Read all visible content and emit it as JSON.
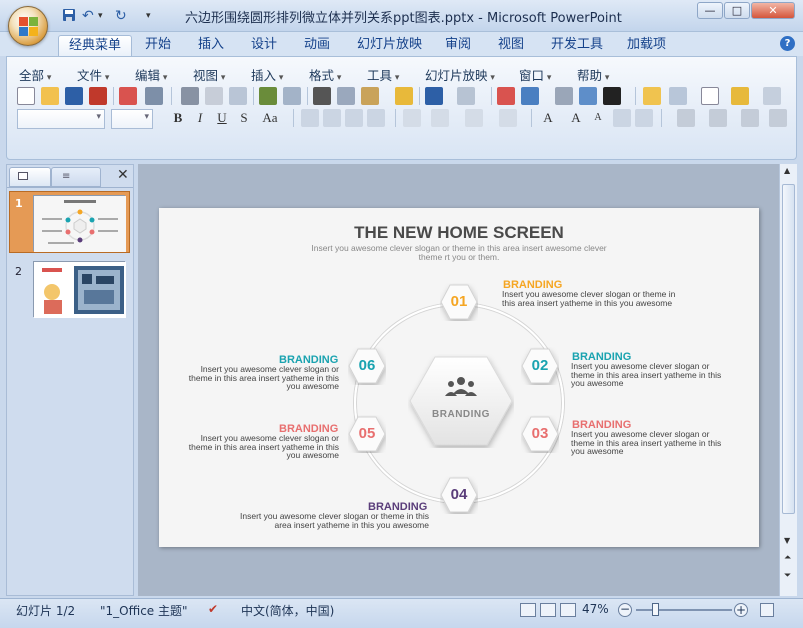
{
  "window": {
    "title": "六边形围绕圆形排列微立体并列关系ppt图表.pptx - Microsoft PowerPoint"
  },
  "ribbon": {
    "tabs": [
      "经典菜单",
      "开始",
      "插入",
      "设计",
      "动画",
      "幻灯片放映",
      "审阅",
      "视图",
      "开发工具",
      "加载项"
    ],
    "active_tab": "经典菜单",
    "menus": [
      "全部",
      "文件",
      "编辑",
      "视图",
      "插入",
      "格式",
      "工具",
      "幻灯片放映",
      "窗口",
      "帮助"
    ],
    "format_buttons": [
      "B",
      "I",
      "U",
      "S",
      "Aa"
    ]
  },
  "slides_pane": {
    "thumbnails": [
      {
        "number": "1",
        "selected": true
      },
      {
        "number": "2",
        "selected": false
      }
    ]
  },
  "slide": {
    "title": "THE NEW HOME SCREEN",
    "subtitle": "Insert you awesome clever slogan or theme in this area insert awesome clever theme rt you or them.",
    "center_label": "BRANDING",
    "items": [
      {
        "num": "01",
        "color": "#f5a623",
        "heading": "BRANDING",
        "text": "Insert you awesome clever slogan or theme in this area insert yatheme in this you awesome"
      },
      {
        "num": "02",
        "color": "#1aa3b0",
        "heading": "BRANDING",
        "text": "Insert you awesome clever slogan or theme in this area insert yatheme in this you awesome"
      },
      {
        "num": "03",
        "color": "#e86f6f",
        "heading": "BRANDING",
        "text": "Insert you awesome clever slogan or theme in this area insert yatheme in this you awesome"
      },
      {
        "num": "04",
        "color": "#5a3d7a",
        "heading": "BRANDING",
        "text": "Insert you awesome clever slogan or theme in this area insert yatheme in this you awesome"
      },
      {
        "num": "05",
        "color": "#e86f6f",
        "heading": "BRANDING",
        "text": "Insert you awesome clever slogan or theme in this area insert yatheme in this you awesome"
      },
      {
        "num": "06",
        "color": "#1aa3b0",
        "heading": "BRANDING",
        "text": "Insert you awesome clever slogan or theme in this area insert yatheme in this you awesome"
      }
    ]
  },
  "statusbar": {
    "slide_counter": "幻灯片 1/2",
    "theme": "\"1_Office 主题\"",
    "language": "中文(简体，中国)",
    "zoom": "47%"
  }
}
